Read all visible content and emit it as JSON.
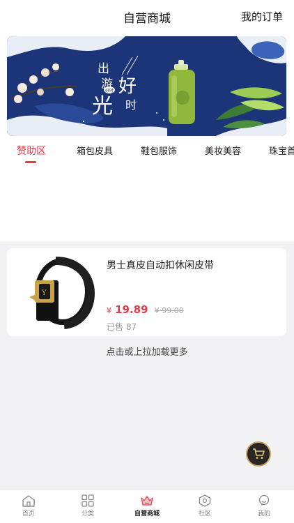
{
  "header": {
    "title": "自营商城",
    "orders_link": "我的订单"
  },
  "banner": {
    "calligraphy": [
      "出",
      "游",
      "好",
      "时",
      "光"
    ],
    "seal": "好时",
    "colors": {
      "background": "#1c3578",
      "bottle": "#8fb83d"
    }
  },
  "category_tabs": [
    {
      "label": "赞助区",
      "active": true
    },
    {
      "label": "箱包皮具",
      "active": false
    },
    {
      "label": "鞋包服饰",
      "active": false
    },
    {
      "label": "美妆美容",
      "active": false
    },
    {
      "label": "珠宝首",
      "active": false
    }
  ],
  "product": {
    "title": "男士真皮自动扣休闲皮带",
    "price_symbol": "¥",
    "price": "19.89",
    "original_price": "¥ 99.00",
    "sold_label": "已售",
    "sold_count": "87"
  },
  "load_more": "点击或上拉加载更多",
  "cart": {
    "icon": "cart-icon"
  },
  "tabbar": [
    {
      "label": "首页",
      "icon": "home-icon"
    },
    {
      "label": "分类",
      "icon": "grid-icon"
    },
    {
      "label": "自营商城",
      "icon": "crown-icon",
      "active": true
    },
    {
      "label": "社区",
      "icon": "hexagon-icon"
    },
    {
      "label": "我的",
      "icon": "profile-icon"
    }
  ],
  "colors": {
    "accent": "#e43b4a",
    "background_gray": "#f2f2f5"
  }
}
